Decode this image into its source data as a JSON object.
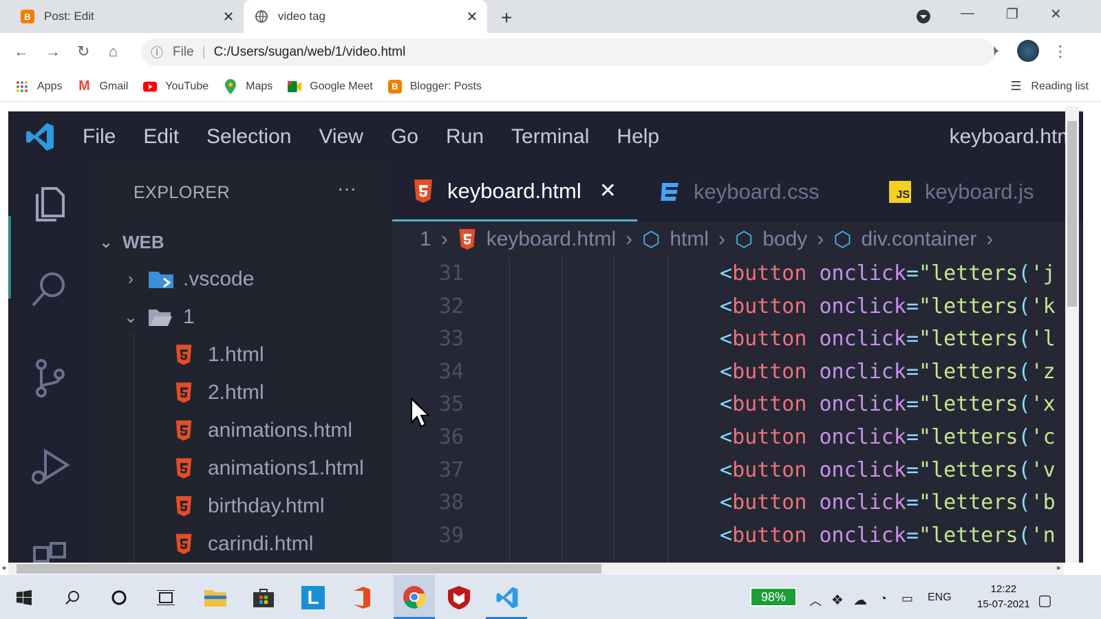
{
  "browser": {
    "tabs": [
      {
        "title": "Post: Edit",
        "icon": "blogger-icon",
        "active": false
      },
      {
        "title": "video tag",
        "icon": "globe-icon",
        "active": true
      }
    ],
    "address": {
      "scheme_label": "File",
      "url": "C:/Users/sugan/web/1/video.html"
    },
    "bookmarks": [
      {
        "label": "Apps",
        "icon": "apps-grid-icon"
      },
      {
        "label": "Gmail",
        "icon": "gmail-icon"
      },
      {
        "label": "YouTube",
        "icon": "youtube-icon"
      },
      {
        "label": "Maps",
        "icon": "maps-pin-icon"
      },
      {
        "label": "Google Meet",
        "icon": "meet-icon"
      },
      {
        "label": "Blogger: Posts",
        "icon": "blogger-icon"
      }
    ],
    "reading_list": "Reading list"
  },
  "vscode": {
    "menu": [
      "File",
      "Edit",
      "Selection",
      "View",
      "Go",
      "Run",
      "Terminal",
      "Help"
    ],
    "window_title": "keyboard.html",
    "explorer": {
      "title": "EXPLORER",
      "more": "···",
      "root": "WEB",
      "items": [
        {
          "label": ".vscode",
          "type": "folder-closed"
        },
        {
          "label": "1",
          "type": "folder-open"
        },
        {
          "label": "1.html",
          "type": "html"
        },
        {
          "label": "2.html",
          "type": "html"
        },
        {
          "label": "animations.html",
          "type": "html"
        },
        {
          "label": "animations1.html",
          "type": "html"
        },
        {
          "label": "birthday.html",
          "type": "html"
        },
        {
          "label": "carindi.html",
          "type": "html"
        }
      ]
    },
    "editor_tabs": [
      {
        "label": "keyboard.html",
        "type": "html",
        "active": true
      },
      {
        "label": "keyboard.css",
        "type": "css",
        "active": false
      },
      {
        "label": "keyboard.js",
        "type": "js",
        "active": false
      }
    ],
    "breadcrumb": [
      "1",
      "keyboard.html",
      "html",
      "body",
      "div.container"
    ],
    "code_lines": [
      {
        "n": "31",
        "letter": "j"
      },
      {
        "n": "32",
        "letter": "k"
      },
      {
        "n": "33",
        "letter": "l"
      },
      {
        "n": "34",
        "letter": "z"
      },
      {
        "n": "35",
        "letter": "x"
      },
      {
        "n": "36",
        "letter": "c"
      },
      {
        "n": "37",
        "letter": "v"
      },
      {
        "n": "38",
        "letter": "b"
      },
      {
        "n": "39",
        "letter": "n"
      }
    ],
    "code_tokens": {
      "lt": "<",
      "tag": "button",
      "attr": "onclick",
      "eq": "=",
      "q": "\"",
      "fn": "letters",
      "paren": "(",
      "sq": "'"
    }
  },
  "taskbar": {
    "battery": "98%",
    "language": "ENG",
    "time": "12:22",
    "date": "15-07-2021"
  }
}
